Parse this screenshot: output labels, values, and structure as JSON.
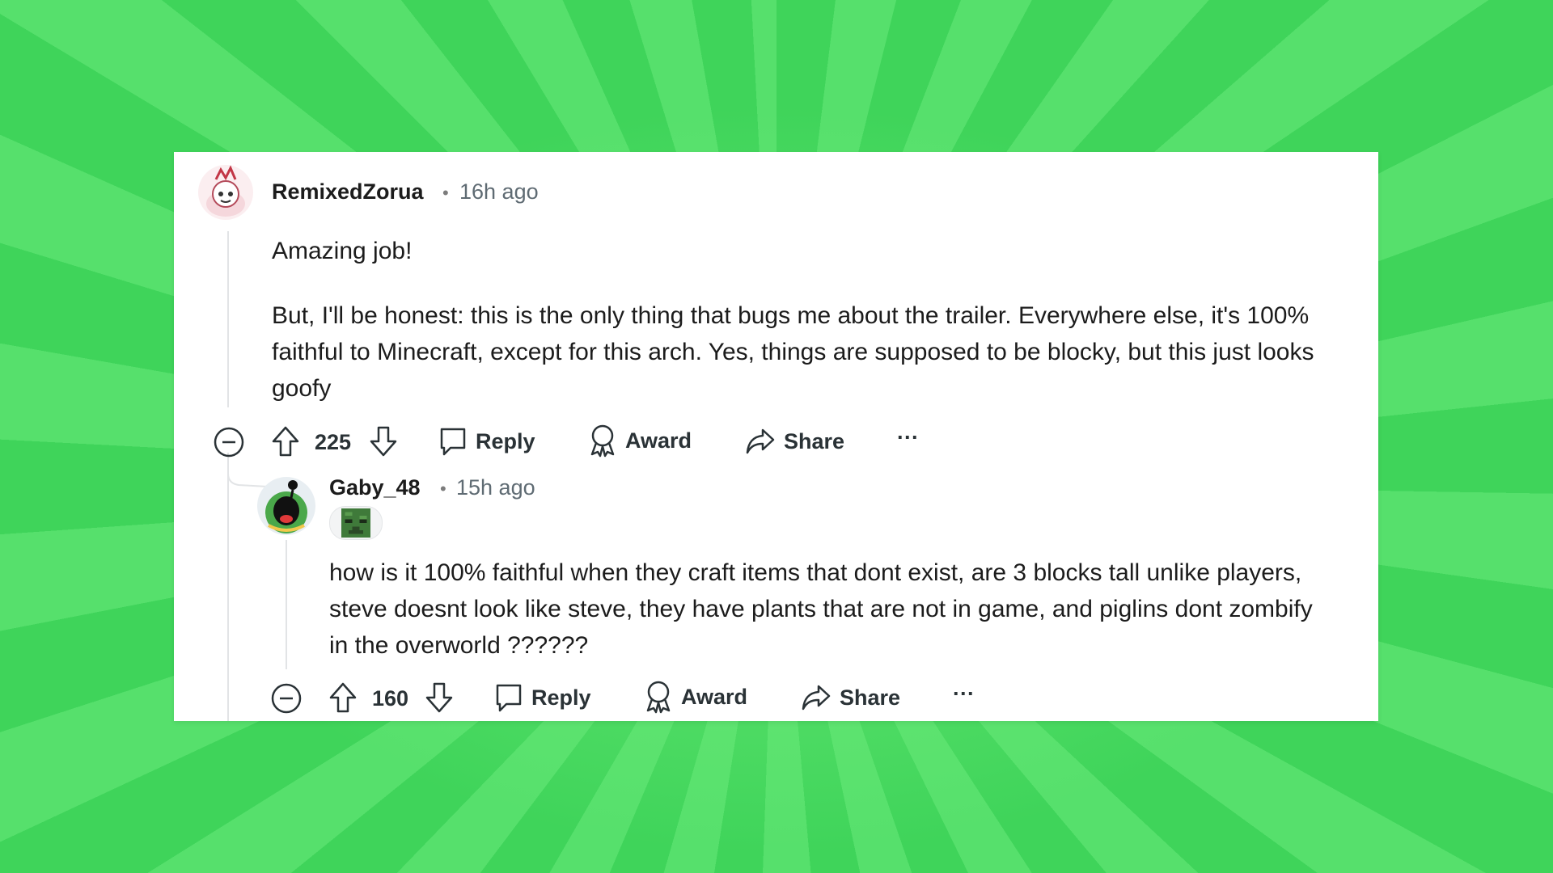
{
  "background_color": "#4cdc62",
  "comments": [
    {
      "username": "RemixedZorua",
      "separator": "•",
      "time": "16h ago",
      "body": [
        "Amazing job!",
        "But, I'll be honest: this is the only thing that bugs me about the trailer. Everywhere else, it's 100% faithful to Minecraft, except for this arch. Yes, things are supposed to be blocky, but this just looks goofy"
      ],
      "votes": "225",
      "actions": {
        "reply": "Reply",
        "award": "Award",
        "share": "Share",
        "more": "···"
      }
    },
    {
      "username": "Gaby_48",
      "separator": "•",
      "time": "15h ago",
      "body": [
        "how is it 100% faithful when they craft items that dont exist, are 3 blocks tall unlike players, steve doesnt look like steve, they have plants that are not in game, and piglins dont zombify in the overworld ??????"
      ],
      "votes": "160",
      "actions": {
        "reply": "Reply",
        "award": "Award",
        "share": "Share",
        "more": "···"
      }
    }
  ],
  "icons": [
    "collapse-icon",
    "upvote-icon",
    "downvote-icon",
    "comment-icon",
    "award-icon",
    "share-icon",
    "more-icon"
  ]
}
